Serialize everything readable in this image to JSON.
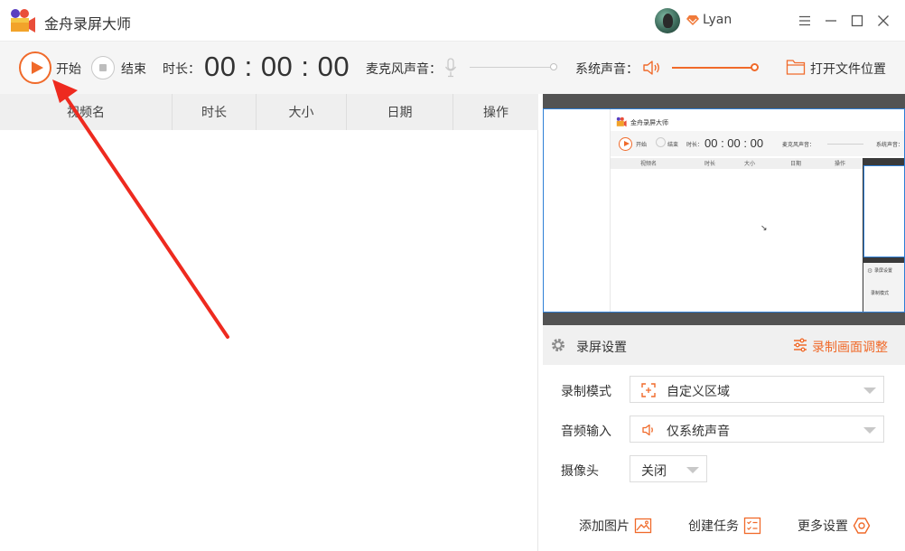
{
  "app": {
    "title": "金舟录屏大师",
    "user_name": "Lyan"
  },
  "toolbar": {
    "start_label": "开始",
    "stop_label": "结束",
    "duration_label": "时长：",
    "timer": "00 : 00 : 00",
    "mic_label": "麦克风声音：",
    "mic_level": 1.0,
    "system_audio_label": "系统声音：",
    "system_audio_level": 1.0,
    "open_folder_label": "打开文件位置"
  },
  "file_list": {
    "columns": [
      "视频名",
      "时长",
      "大小",
      "日期",
      "操作"
    ],
    "rows": []
  },
  "preview": {
    "mini": {
      "title": "金舟录屏大师",
      "start": "开始",
      "stop": "结束",
      "duration": "时长：",
      "timer": "00 : 00 : 00",
      "mic": "麦克风声音：",
      "sys": "系统声音：",
      "columns": [
        "视频名",
        "时长",
        "大小",
        "日期",
        "操作"
      ],
      "settings_title": "录屏设置",
      "mode_label": "录制模式"
    }
  },
  "settings": {
    "title": "录屏设置",
    "adjust_label": "录制画面调整",
    "mode_label": "录制模式",
    "mode_value": "自定义区域",
    "audio_label": "音频输入",
    "audio_value": "仅系统声音",
    "camera_label": "摄像头",
    "camera_value": "关闭",
    "add_image_label": "添加图片",
    "create_task_label": "创建任务",
    "more_settings_label": "更多设置"
  },
  "colors": {
    "accent": "#f06a2a",
    "preview_bg": "#535353",
    "selection_border": "#2e7fd6",
    "annotation_arrow": "#ee2a1f"
  }
}
